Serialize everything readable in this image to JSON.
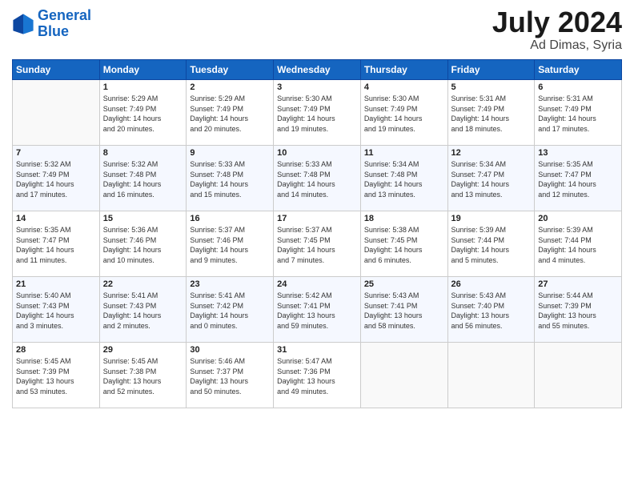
{
  "header": {
    "logo_line1": "General",
    "logo_line2": "Blue",
    "month_year": "July 2024",
    "location": "Ad Dimas, Syria"
  },
  "weekdays": [
    "Sunday",
    "Monday",
    "Tuesday",
    "Wednesday",
    "Thursday",
    "Friday",
    "Saturday"
  ],
  "weeks": [
    [
      {
        "day": "",
        "info": ""
      },
      {
        "day": "1",
        "info": "Sunrise: 5:29 AM\nSunset: 7:49 PM\nDaylight: 14 hours\nand 20 minutes."
      },
      {
        "day": "2",
        "info": "Sunrise: 5:29 AM\nSunset: 7:49 PM\nDaylight: 14 hours\nand 20 minutes."
      },
      {
        "day": "3",
        "info": "Sunrise: 5:30 AM\nSunset: 7:49 PM\nDaylight: 14 hours\nand 19 minutes."
      },
      {
        "day": "4",
        "info": "Sunrise: 5:30 AM\nSunset: 7:49 PM\nDaylight: 14 hours\nand 19 minutes."
      },
      {
        "day": "5",
        "info": "Sunrise: 5:31 AM\nSunset: 7:49 PM\nDaylight: 14 hours\nand 18 minutes."
      },
      {
        "day": "6",
        "info": "Sunrise: 5:31 AM\nSunset: 7:49 PM\nDaylight: 14 hours\nand 17 minutes."
      }
    ],
    [
      {
        "day": "7",
        "info": "Sunrise: 5:32 AM\nSunset: 7:49 PM\nDaylight: 14 hours\nand 17 minutes."
      },
      {
        "day": "8",
        "info": "Sunrise: 5:32 AM\nSunset: 7:48 PM\nDaylight: 14 hours\nand 16 minutes."
      },
      {
        "day": "9",
        "info": "Sunrise: 5:33 AM\nSunset: 7:48 PM\nDaylight: 14 hours\nand 15 minutes."
      },
      {
        "day": "10",
        "info": "Sunrise: 5:33 AM\nSunset: 7:48 PM\nDaylight: 14 hours\nand 14 minutes."
      },
      {
        "day": "11",
        "info": "Sunrise: 5:34 AM\nSunset: 7:48 PM\nDaylight: 14 hours\nand 13 minutes."
      },
      {
        "day": "12",
        "info": "Sunrise: 5:34 AM\nSunset: 7:47 PM\nDaylight: 14 hours\nand 13 minutes."
      },
      {
        "day": "13",
        "info": "Sunrise: 5:35 AM\nSunset: 7:47 PM\nDaylight: 14 hours\nand 12 minutes."
      }
    ],
    [
      {
        "day": "14",
        "info": "Sunrise: 5:35 AM\nSunset: 7:47 PM\nDaylight: 14 hours\nand 11 minutes."
      },
      {
        "day": "15",
        "info": "Sunrise: 5:36 AM\nSunset: 7:46 PM\nDaylight: 14 hours\nand 10 minutes."
      },
      {
        "day": "16",
        "info": "Sunrise: 5:37 AM\nSunset: 7:46 PM\nDaylight: 14 hours\nand 9 minutes."
      },
      {
        "day": "17",
        "info": "Sunrise: 5:37 AM\nSunset: 7:45 PM\nDaylight: 14 hours\nand 7 minutes."
      },
      {
        "day": "18",
        "info": "Sunrise: 5:38 AM\nSunset: 7:45 PM\nDaylight: 14 hours\nand 6 minutes."
      },
      {
        "day": "19",
        "info": "Sunrise: 5:39 AM\nSunset: 7:44 PM\nDaylight: 14 hours\nand 5 minutes."
      },
      {
        "day": "20",
        "info": "Sunrise: 5:39 AM\nSunset: 7:44 PM\nDaylight: 14 hours\nand 4 minutes."
      }
    ],
    [
      {
        "day": "21",
        "info": "Sunrise: 5:40 AM\nSunset: 7:43 PM\nDaylight: 14 hours\nand 3 minutes."
      },
      {
        "day": "22",
        "info": "Sunrise: 5:41 AM\nSunset: 7:43 PM\nDaylight: 14 hours\nand 2 minutes."
      },
      {
        "day": "23",
        "info": "Sunrise: 5:41 AM\nSunset: 7:42 PM\nDaylight: 14 hours\nand 0 minutes."
      },
      {
        "day": "24",
        "info": "Sunrise: 5:42 AM\nSunset: 7:41 PM\nDaylight: 13 hours\nand 59 minutes."
      },
      {
        "day": "25",
        "info": "Sunrise: 5:43 AM\nSunset: 7:41 PM\nDaylight: 13 hours\nand 58 minutes."
      },
      {
        "day": "26",
        "info": "Sunrise: 5:43 AM\nSunset: 7:40 PM\nDaylight: 13 hours\nand 56 minutes."
      },
      {
        "day": "27",
        "info": "Sunrise: 5:44 AM\nSunset: 7:39 PM\nDaylight: 13 hours\nand 55 minutes."
      }
    ],
    [
      {
        "day": "28",
        "info": "Sunrise: 5:45 AM\nSunset: 7:39 PM\nDaylight: 13 hours\nand 53 minutes."
      },
      {
        "day": "29",
        "info": "Sunrise: 5:45 AM\nSunset: 7:38 PM\nDaylight: 13 hours\nand 52 minutes."
      },
      {
        "day": "30",
        "info": "Sunrise: 5:46 AM\nSunset: 7:37 PM\nDaylight: 13 hours\nand 50 minutes."
      },
      {
        "day": "31",
        "info": "Sunrise: 5:47 AM\nSunset: 7:36 PM\nDaylight: 13 hours\nand 49 minutes."
      },
      {
        "day": "",
        "info": ""
      },
      {
        "day": "",
        "info": ""
      },
      {
        "day": "",
        "info": ""
      }
    ]
  ]
}
